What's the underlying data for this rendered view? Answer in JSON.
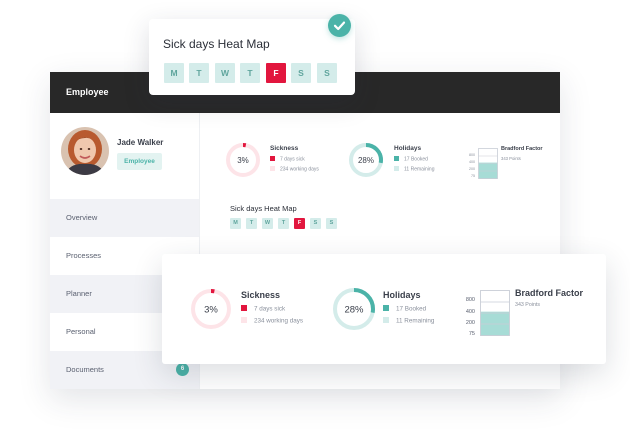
{
  "header": {
    "title": "Employee"
  },
  "profile": {
    "name": "Jade Walker",
    "role": "Employee"
  },
  "sidebar": {
    "items": [
      {
        "label": "Overview"
      },
      {
        "label": "Processes"
      },
      {
        "label": "Planner"
      },
      {
        "label": "Personal"
      },
      {
        "label": "Documents",
        "count": "6"
      }
    ]
  },
  "stats": {
    "sickness": {
      "title": "Sickness",
      "percent": "3%",
      "fraction": 0.03,
      "legend": [
        "7 days sick",
        "234 working days"
      ]
    },
    "holidays": {
      "title": "Holidays",
      "percent": "28%",
      "fraction": 0.28,
      "legend": [
        "17 Booked",
        "11 Remaining"
      ]
    },
    "bradford": {
      "title": "Bradford Factor",
      "points": "343 Points",
      "ticks": [
        "800",
        "400",
        "200",
        "75"
      ],
      "level": 343
    }
  },
  "heatmap": {
    "title": "Sick days Heat Map",
    "days": [
      "M",
      "T",
      "W",
      "T",
      "F",
      "S",
      "S"
    ],
    "highlight_index": 4
  },
  "colors": {
    "accent": "#4bb3a8",
    "sick": "#e2163e",
    "sick_light": "#fde4e8",
    "teal_light": "#d4ecea",
    "header_bg": "#282828"
  },
  "icons": {
    "check": "check-icon"
  }
}
